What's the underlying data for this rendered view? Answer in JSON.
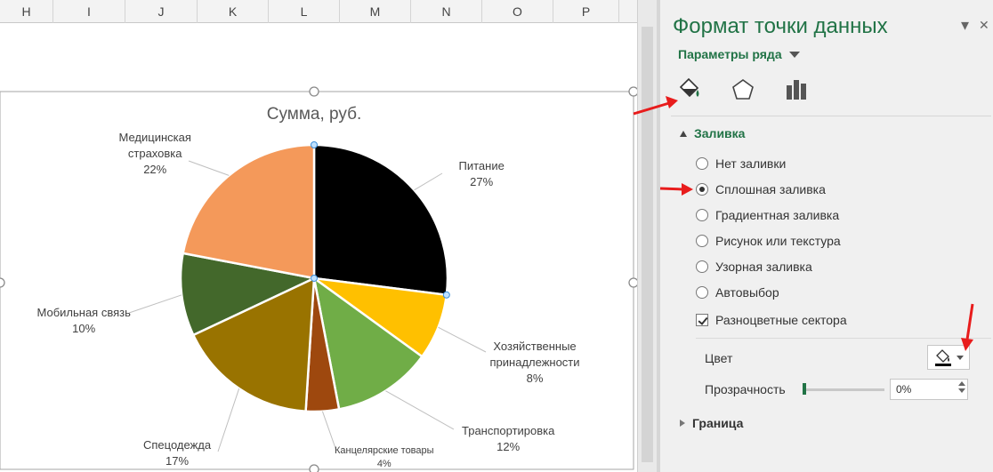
{
  "sheet": {
    "columns": [
      "H",
      "I",
      "J",
      "K",
      "L",
      "M",
      "N",
      "O",
      "P"
    ]
  },
  "chart": {
    "title": "Сумма, руб."
  },
  "chart_data": {
    "type": "pie",
    "title": "Сумма, руб.",
    "categories": [
      "Питание",
      "Хозяйственные принадлежности",
      "Транспортировка",
      "Канцелярские товары",
      "Спецодежда",
      "Мобильная связь",
      "Медицинская страховка"
    ],
    "values": [
      27,
      8,
      12,
      4,
      17,
      10,
      22
    ],
    "unit": "%",
    "colors": [
      "#000000",
      "#ffc000",
      "#70ad47",
      "#9e480e",
      "#997300",
      "#43682b",
      "#f4995a"
    ],
    "labels": [
      {
        "lines": [
          "Питание",
          "27%"
        ]
      },
      {
        "lines": [
          "Хозяйственные",
          "принадлежности",
          "8%"
        ]
      },
      {
        "lines": [
          "Транспортировка",
          "12%"
        ]
      },
      {
        "lines": [
          "Канцелярские товары",
          "4%"
        ]
      },
      {
        "lines": [
          "Спецодежда",
          "17%"
        ]
      },
      {
        "lines": [
          "Мобильная связь",
          "10%"
        ]
      },
      {
        "lines": [
          "Медицинская",
          "страховка",
          "22%"
        ]
      }
    ],
    "legend": "none"
  },
  "pane": {
    "title": "Формат точки данных",
    "options_label": "Параметры ряда",
    "fill_section": "Заливка",
    "border_section": "Граница",
    "fill_options": [
      {
        "label": "Нет заливки",
        "selected": false
      },
      {
        "label": "Сплошная заливка",
        "selected": true
      },
      {
        "label": "Градиентная заливка",
        "selected": false
      },
      {
        "label": "Рисунок или текстура",
        "selected": false
      },
      {
        "label": "Узорная заливка",
        "selected": false
      },
      {
        "label": "Автовыбор",
        "selected": false
      }
    ],
    "vary_colors_label": "Разноцветные сектора",
    "vary_colors_checked": true,
    "color_label": "Цвет",
    "transparency_label": "Прозрачность",
    "transparency_value": "0%",
    "accent_color": "#217346",
    "annotation_color": "#e81c1c"
  }
}
